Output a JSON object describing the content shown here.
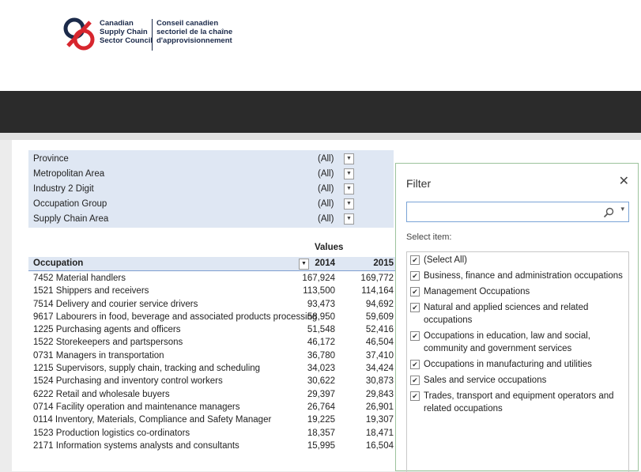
{
  "logo": {
    "en_line1": "Canadian",
    "en_line2": "Supply Chain",
    "en_line3": "Sector Council",
    "fr_line1": "Conseil canadien",
    "fr_line2": "sectoriel de la chaîne",
    "fr_line3": "d'approvisionnement",
    "colors": {
      "red": "#d7262e",
      "navy": "#1b2a4a"
    }
  },
  "filters": [
    {
      "label": "Province",
      "value": "(All)"
    },
    {
      "label": "Metropolitan Area",
      "value": "(All)"
    },
    {
      "label": "Industry 2 Digit",
      "value": "(All)"
    },
    {
      "label": "Occupation Group",
      "value": "(All)"
    },
    {
      "label": "Supply Chain Area",
      "value": "(All)"
    }
  ],
  "pivot": {
    "values_label": "Values",
    "row_header": "Occupation",
    "col_headers": [
      "2014",
      "2015"
    ],
    "rows": [
      {
        "name": "7452 Material handlers",
        "v2014": "167,924",
        "v2015": "169,772"
      },
      {
        "name": "1521 Shippers and receivers",
        "v2014": "113,500",
        "v2015": "114,164"
      },
      {
        "name": "7514 Delivery and courier service drivers",
        "v2014": "93,473",
        "v2015": "94,692"
      },
      {
        "name": "9617 Labourers in food, beverage and associated products processing",
        "v2014": "58,950",
        "v2015": "59,609"
      },
      {
        "name": "1225 Purchasing agents and officers",
        "v2014": "51,548",
        "v2015": "52,416"
      },
      {
        "name": "1522 Storekeepers and partspersons",
        "v2014": "46,172",
        "v2015": "46,504"
      },
      {
        "name": "0731 Managers in transportation",
        "v2014": "36,780",
        "v2015": "37,410"
      },
      {
        "name": "1215 Supervisors, supply chain, tracking and scheduling",
        "v2014": "34,023",
        "v2015": "34,424"
      },
      {
        "name": "1524 Purchasing and inventory control workers",
        "v2014": "30,622",
        "v2015": "30,873"
      },
      {
        "name": "6222 Retail and wholesale buyers",
        "v2014": "29,397",
        "v2015": "29,843"
      },
      {
        "name": "0714 Facility operation and maintenance managers",
        "v2014": "26,764",
        "v2015": "26,901"
      },
      {
        "name": "0114 Inventory, Materials, Compliance and Safety Manager",
        "v2014": "19,225",
        "v2015": "19,307"
      },
      {
        "name": "1523 Production logistics co-ordinators",
        "v2014": "18,357",
        "v2015": "18,471"
      },
      {
        "name": "2171 Information systems analysts and consultants",
        "v2014": "15,995",
        "v2015": "16,504"
      }
    ]
  },
  "filter_pane": {
    "title": "Filter",
    "close_icon": "close-icon",
    "search_value": "",
    "select_label": "Select item:",
    "items": [
      {
        "label": "(Select All)",
        "checked": true
      },
      {
        "label": "Business, finance and administration occupations",
        "checked": true
      },
      {
        "label": "Management Occupations",
        "checked": true
      },
      {
        "label": "Natural and applied sciences and related occupations",
        "checked": true
      },
      {
        "label": "Occupations in education, law and social, community and government services",
        "checked": true
      },
      {
        "label": "Occupations in manufacturing and utilities",
        "checked": true
      },
      {
        "label": "Sales and service occupations",
        "checked": true
      },
      {
        "label": "Trades, transport and equipment operators and related occupations",
        "checked": true
      }
    ]
  }
}
